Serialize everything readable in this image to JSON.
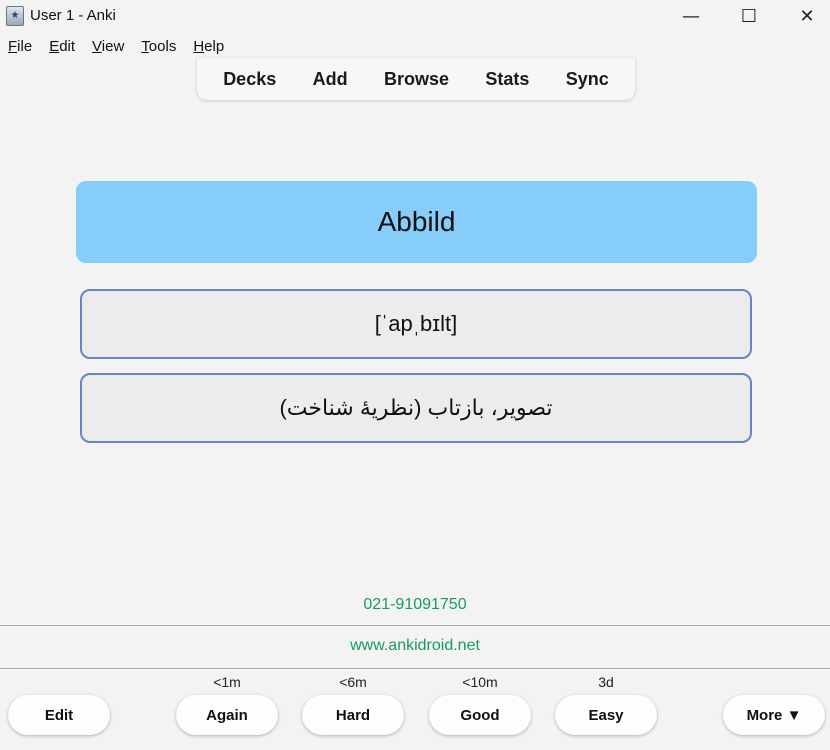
{
  "window": {
    "title": "User 1 - Anki",
    "minimize": "—",
    "maximize": "☐",
    "close": "✕"
  },
  "menu": [
    {
      "underline": "F",
      "rest": "ile"
    },
    {
      "underline": "E",
      "rest": "dit"
    },
    {
      "underline": "V",
      "rest": "iew"
    },
    {
      "underline": "T",
      "rest": "ools"
    },
    {
      "underline": "H",
      "rest": "elp"
    }
  ],
  "toolbar": {
    "decks": "Decks",
    "add": "Add",
    "browse": "Browse",
    "stats": "Stats",
    "sync": "Sync"
  },
  "card": {
    "word": "Abbild",
    "ipa": "[ˈapˌbɪlt]",
    "translation": "تصویر، بازتاب (نظریهٔ شناخت)",
    "phone": "021-91091750",
    "website": "www.ankidroid.net"
  },
  "answer_bar": {
    "edit": "Edit",
    "again": {
      "label": "Again",
      "interval": "<1m"
    },
    "hard": {
      "label": "Hard",
      "interval": "<6m"
    },
    "good": {
      "label": "Good",
      "interval": "<10m"
    },
    "easy": {
      "label": "Easy",
      "interval": "3d"
    },
    "more": "More ▼"
  },
  "colors": {
    "word_bg": "#87cdf9",
    "box_border": "#6a84c0",
    "footer_text": "#1a9a5c"
  }
}
